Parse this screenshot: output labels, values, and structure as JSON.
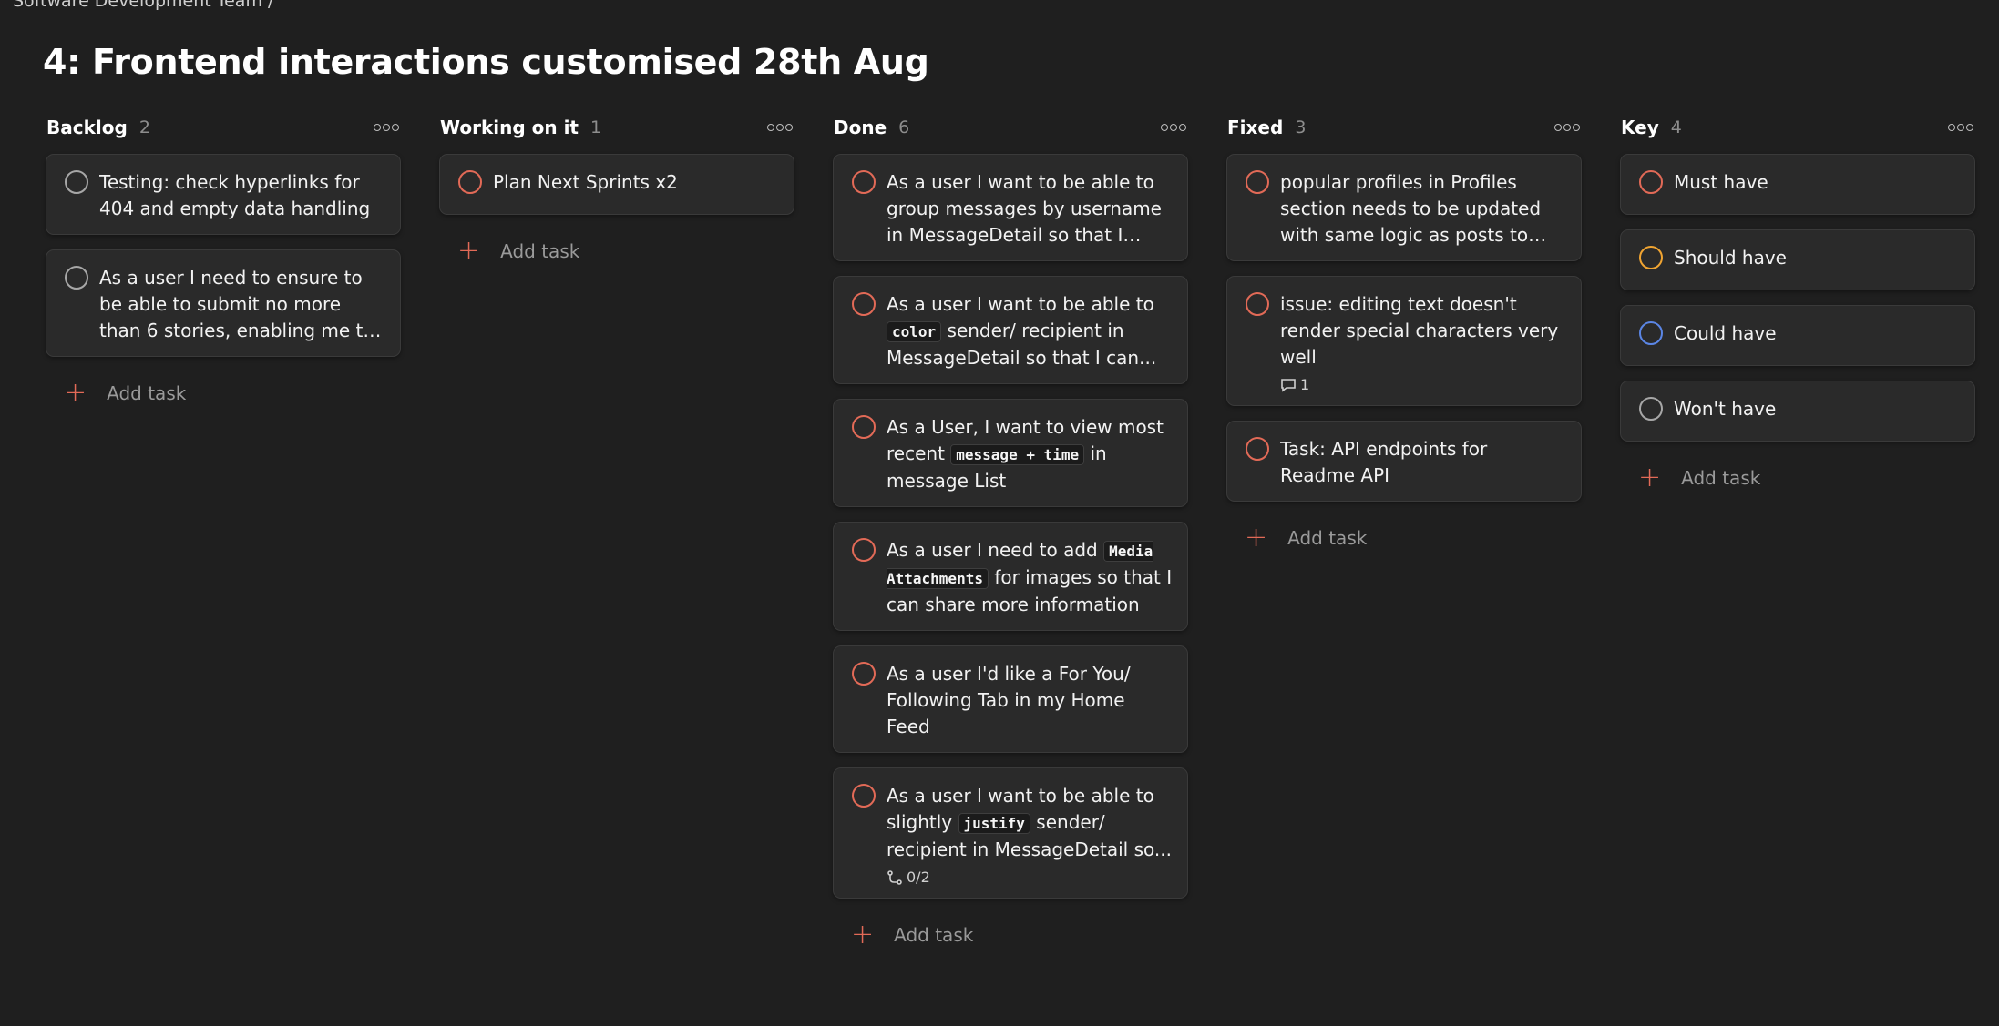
{
  "breadcrumb": "Software Development Team /",
  "page_title": "4: Frontend interactions customised 28th Aug",
  "add_task_label": "Add task",
  "colors": {
    "must": "#e26a57",
    "should": "#f0a431",
    "could": "#5b86e5",
    "wont": "#a7a7a7"
  },
  "columns": [
    {
      "name": "Backlog",
      "count": "2",
      "cards": [
        {
          "text": "Testing: check hyperlinks for 404 and empty data handling"
        },
        {
          "text": "As a user I need to ensure to be able to submit no more than 6 stories, enabling me to have a..."
        }
      ]
    },
    {
      "name": "Working on it",
      "count": "1",
      "cards": [
        {
          "text": "Plan Next Sprints x2"
        }
      ]
    },
    {
      "name": "Done",
      "count": "6",
      "cards": [
        {
          "text": "As a user I want to be able to group messages by username in MessageDetail so that I can..."
        },
        {
          "text_before": "As a user I want to be able to",
          "code": "color",
          "text_after": "sender/ recipient in MessageDetail so that I can..."
        },
        {
          "text_before": "As a User, I want to view most recent",
          "code": "message + time",
          "text_after": "in message List"
        },
        {
          "text_before": "As a user I need to add",
          "code": "Media Attachments",
          "text_after": "for images so that I can share more information"
        },
        {
          "text": "As a user I'd like a For You/ Following Tab in my Home Feed"
        },
        {
          "text_before": "As a user I want to be able to slightly",
          "code": "justify",
          "text_after": "sender/ recipient in MessageDetail so...",
          "subtasks": "0/2",
          "subtask_icon": "subtask-icon"
        }
      ]
    },
    {
      "name": "Fixed",
      "count": "3",
      "cards": [
        {
          "text": "popular profiles in Profiles section needs to be updated with same logic as posts to fix..."
        },
        {
          "text": "issue: editing text doesn't render special characters very well",
          "comments": "1",
          "comment_icon": "comment-icon"
        },
        {
          "text": "Task: API endpoints for Readme API"
        }
      ]
    },
    {
      "name": "Key",
      "count": "4",
      "cards": [
        {
          "text": "Must have"
        },
        {
          "text": "Should have"
        },
        {
          "text": "Could have"
        },
        {
          "text": "Won't have"
        }
      ]
    }
  ]
}
